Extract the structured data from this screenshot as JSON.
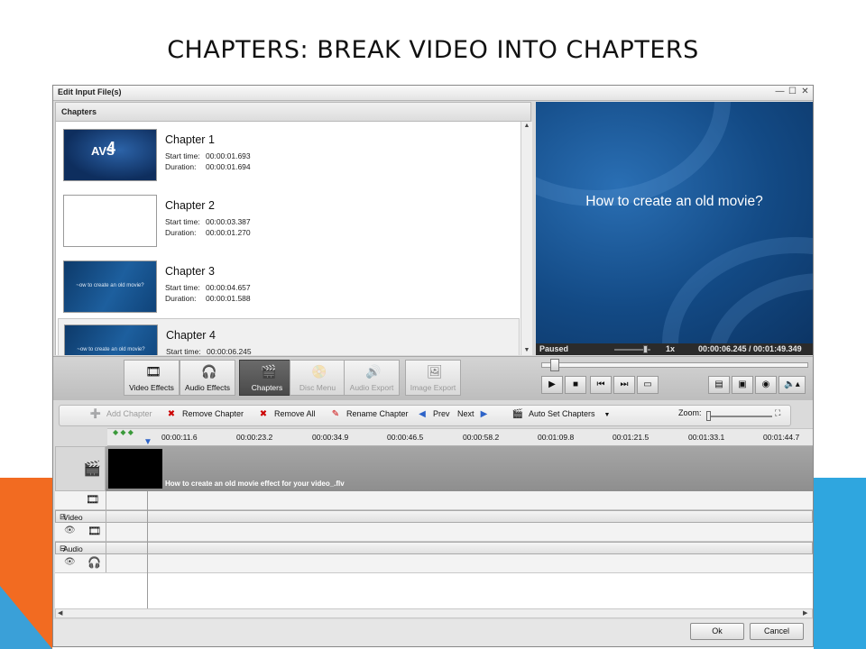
{
  "slide": {
    "title": "CHAPTERS: BREAK VIDEO INTO CHAPTERS"
  },
  "window": {
    "title": "Edit Input File(s)",
    "controls": {
      "minimize": "—",
      "maximize": "☐",
      "close": "✕"
    }
  },
  "chapters_panel": {
    "header": "Chapters",
    "start_label": "Start time:",
    "duration_label": "Duration:",
    "items": [
      {
        "name": "Chapter 1",
        "start": "00:00:01.693",
        "duration": "00:00:01.694",
        "thumb": "logo",
        "thumb_text": "AVS4YOU"
      },
      {
        "name": "Chapter 2",
        "start": "00:00:03.387",
        "duration": "00:00:01.270",
        "thumb": "blank",
        "thumb_text": ""
      },
      {
        "name": "Chapter 3",
        "start": "00:00:04.657",
        "duration": "00:00:01.588",
        "thumb": "slide",
        "thumb_text": "~ow to create an old movie?"
      },
      {
        "name": "Chapter 4",
        "start": "00:00:06.245",
        "duration": "",
        "thumb": "slide",
        "thumb_text": "~ow to create an old movie?"
      }
    ]
  },
  "preview": {
    "text": "How to create an old movie?",
    "status": "Paused",
    "speed": "1x",
    "time": "00:00:06.245 / 00:01:49.349"
  },
  "toolbar": {
    "tools": [
      {
        "label": "Video Effects",
        "icon": "video-effects-icon",
        "state": "normal"
      },
      {
        "label": "Audio Effects",
        "icon": "audio-effects-icon",
        "state": "normal"
      },
      {
        "label": "Chapters",
        "icon": "chapters-icon",
        "state": "active"
      },
      {
        "label": "Disc Menu",
        "icon": "disc-menu-icon",
        "state": "disabled"
      },
      {
        "label": "Audio Export",
        "icon": "audio-export-icon",
        "state": "disabled"
      },
      {
        "label": "Image Export",
        "icon": "image-export-icon",
        "state": "disabled"
      }
    ]
  },
  "timeline_toolbar": {
    "add_chapter": "Add Chapter",
    "remove_chapter": "Remove Chapter",
    "remove_all": "Remove All",
    "rename_chapter": "Rename Chapter",
    "prev": "Prev",
    "next": "Next",
    "auto_set": "Auto Set Chapters",
    "zoom_label": "Zoom:"
  },
  "ruler": {
    "ticks": [
      "00:00:11.6",
      "00:00:23.2",
      "00:00:34.9",
      "00:00:46.5",
      "00:00:58.2",
      "00:01:09.8",
      "00:01:21.5",
      "00:01:33.1",
      "00:01:44.7"
    ]
  },
  "tracks": {
    "clip_name": "How to create an old movie effect for your video_.flv",
    "video_effects": "Video Effects",
    "audio_effects": "Audio Effects"
  },
  "footer": {
    "ok": "Ok",
    "cancel": "Cancel"
  },
  "colors": {
    "accent_orange": "#f26b21",
    "accent_blue": "#2fa6df",
    "active_tool": "#4a4a4a"
  }
}
